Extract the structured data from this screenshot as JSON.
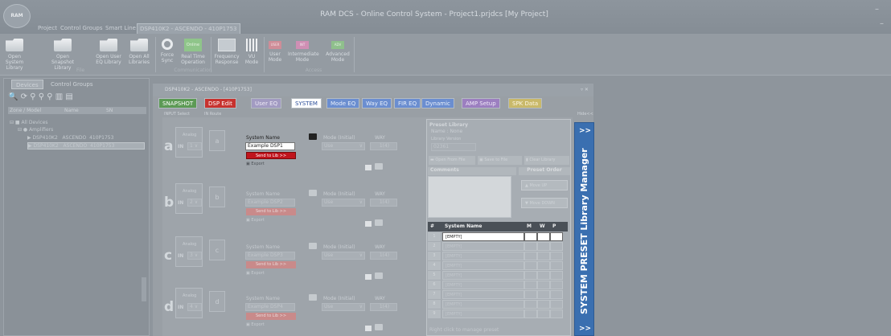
{
  "app": {
    "logo_text": "RAM",
    "title": "RAM DCS - Online Control System - Project1.prjdcs [My Project]",
    "minimize": "–",
    "close": "–"
  },
  "menu_tabs": [
    "Project",
    "Control Groups",
    "Smart Line",
    "DSP410K2 - ASCENDO - 410P1753"
  ],
  "ribbon": {
    "buttons": [
      {
        "label": "Open System Library",
        "icon": "folder-icon"
      },
      {
        "label": "Open Snapshot Library",
        "icon": "folder-icon"
      },
      {
        "label": "Open User EQ Library",
        "icon": "folder-icon"
      },
      {
        "label": "Open All Libraries",
        "icon": "folder-icon"
      },
      {
        "label": "Force Sync",
        "icon": "sync-icon"
      },
      {
        "label": "Real Time Operation",
        "icon": "online-icon",
        "badge": "Online"
      },
      {
        "label": "Frequency Response",
        "icon": "frequency-icon"
      },
      {
        "label": "VU Mode",
        "icon": "vu-icon"
      },
      {
        "label": "User Mode",
        "icon": "user-mode-icon",
        "badge": "USER"
      },
      {
        "label": "Intermediate Mode",
        "icon": "intermediate-icon",
        "badge": "INT"
      },
      {
        "label": "Advanced Mode",
        "icon": "advanced-icon",
        "badge": "ADV"
      }
    ],
    "groups": [
      "File",
      "Communication",
      "",
      "Access"
    ]
  },
  "left_panel": {
    "tabs": [
      "Devices",
      "Control Groups"
    ],
    "headers": [
      "Zone / Model",
      "Name",
      "SN"
    ],
    "tree": [
      {
        "label": "All Devices"
      },
      {
        "label": "Amplifiers"
      },
      {
        "label": "DSP410K2",
        "name": "ASCENDO",
        "sn": "410P1753"
      },
      {
        "label": "DSP410K2",
        "name": "ASCENDO",
        "sn": "410P1753",
        "selected": true
      }
    ]
  },
  "main": {
    "title": "DSP410K2 - ASCENDO - [410P1753]",
    "pin": "▿ ✕",
    "tabs": [
      {
        "label": "SNAPSHOT",
        "bg": "#5c9a55",
        "fg": "#ffffff"
      },
      {
        "label": "DSP Edit",
        "bg": "#c7322e",
        "fg": "#ffffff"
      },
      {
        "label": "User EQ",
        "bg": "#a29bc2",
        "fg": "#eeeaf6"
      },
      {
        "label": "SYSTEM",
        "bg": "#ffffff",
        "fg": "#2c4f9a"
      },
      {
        "label": "Mode EQ",
        "bg": "#6b8ed0",
        "fg": "#e7eefa"
      },
      {
        "label": "Way EQ",
        "bg": "#6b8ed0",
        "fg": "#e7eefa"
      },
      {
        "label": "FIR EQ",
        "bg": "#6b8ed0",
        "fg": "#e7eefa"
      },
      {
        "label": "Dynamic",
        "bg": "#6b8ed0",
        "fg": "#e7eefa"
      },
      {
        "label": "AMP Setup",
        "bg": "#9c7fc0",
        "fg": "#f0e9f8"
      },
      {
        "label": "SPK Data",
        "bg": "#c9b96a",
        "fg": "#fbf6e4"
      }
    ],
    "input_select": "INPUT Select",
    "in_route": "IN Route",
    "hide": "Hide<<"
  },
  "channels": [
    {
      "letter": "a",
      "analog": "Analog",
      "in": "IN",
      "sel": "1",
      "route": "a",
      "sys_label": "System Name",
      "sys_value": "Example DSP1",
      "mode_label": "Mode (Initial)",
      "mode_value": "Use",
      "way": "WAY",
      "way_value": "1(4)",
      "send": "Send to Lib >>",
      "export": "Export",
      "active": true
    },
    {
      "letter": "b",
      "analog": "Analog",
      "in": "IN",
      "sel": "2",
      "route": "b",
      "sys_label": "System Name",
      "sys_value": "Example DSP2",
      "mode_label": "Mode (Initial)",
      "mode_value": "Use",
      "way": "WAY",
      "way_value": "1(4)",
      "send": "Send to Lib >>",
      "export": "Export",
      "active": false
    },
    {
      "letter": "c",
      "analog": "Analog",
      "in": "IN",
      "sel": "3",
      "route": "c",
      "sys_label": "System Name",
      "sys_value": "Example DSP3",
      "mode_label": "Mode (Initial)",
      "mode_value": "Use",
      "way": "WAY",
      "way_value": "1(4)",
      "send": "Send to Lib >>",
      "export": "Export",
      "active": false
    },
    {
      "letter": "d",
      "analog": "Analog",
      "in": "IN",
      "sel": "4",
      "route": "d",
      "sys_label": "System Name",
      "sys_value": "Example DSP4",
      "mode_label": "Mode (Initial)",
      "mode_value": "Use",
      "way": "WAY",
      "way_value": "1(4)",
      "send": "Send to Lib >>",
      "export": "Export",
      "active": false
    }
  ],
  "preset_library": {
    "title": "Preset Library",
    "name": "Name : None",
    "version_label": "Library Version",
    "version_value": "02361",
    "open_btn": "Open From File",
    "save_btn": "Save to File",
    "clear_btn": "Clear Library",
    "comments": "Comments",
    "preset_order": "Preset Order",
    "move_up": "Move UP",
    "move_down": "Move DOWN",
    "table_headers": [
      "#",
      "System Name",
      "M",
      "W",
      "P"
    ],
    "rows": [
      "[EMPTY]",
      "[EMPTY]",
      "[EMPTY]",
      "[EMPTY]",
      "[EMPTY]",
      "[EMPTY]",
      "[EMPTY]",
      "[EMPTY]",
      "[EMPTY]"
    ],
    "row_numbers": [
      "1",
      "2",
      "3",
      "4",
      "5",
      "6",
      "7",
      "8",
      "9"
    ],
    "right_click": "Right click to manage preset"
  },
  "library_manager": {
    "label": "SYSTEM PRESET Library Manager",
    "top_arrow": ">>",
    "bottom_arrow": ">>"
  }
}
